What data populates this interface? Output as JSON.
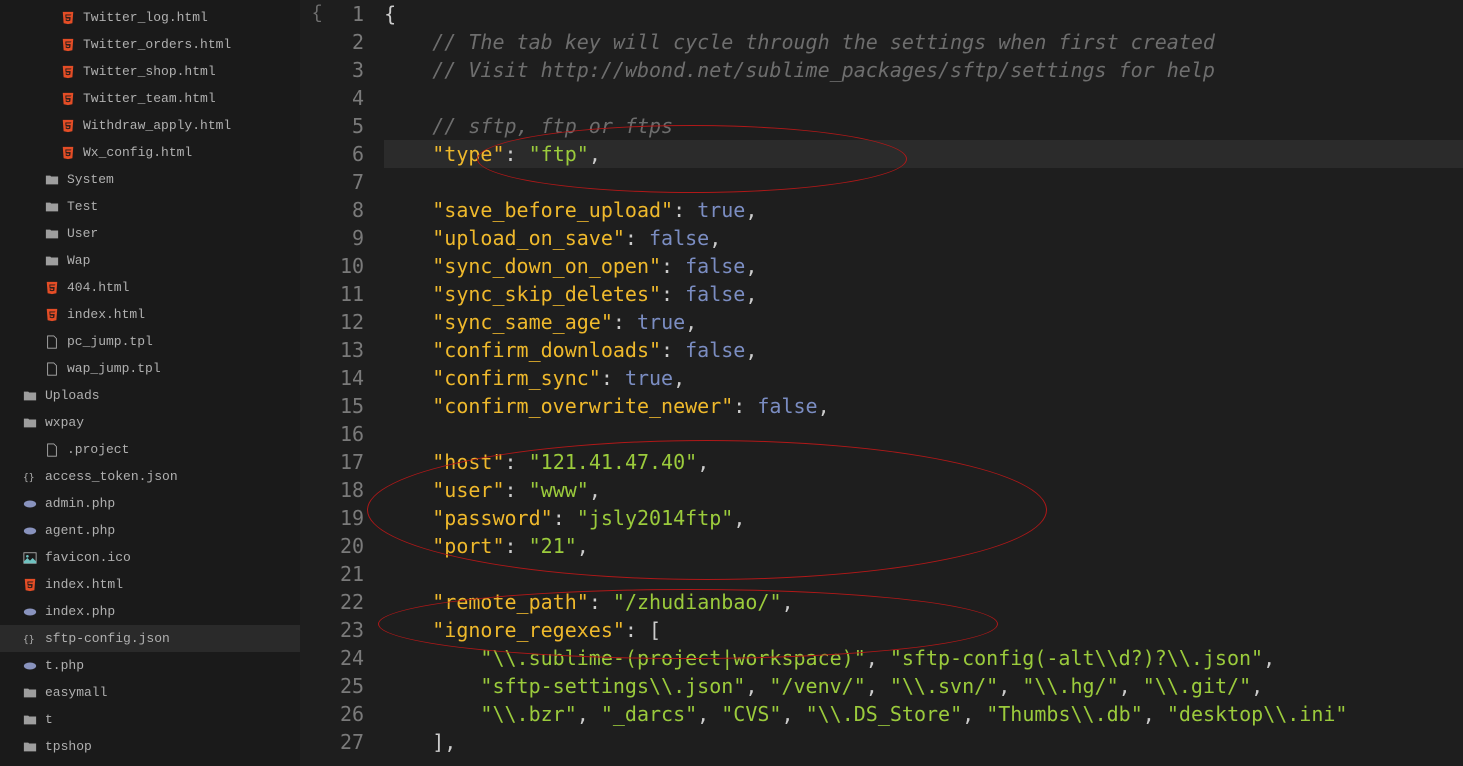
{
  "sidebar": {
    "items": [
      {
        "indent": 3,
        "icon": "html",
        "label": "Twitter_log.html",
        "active": false
      },
      {
        "indent": 3,
        "icon": "html",
        "label": "Twitter_orders.html",
        "active": false
      },
      {
        "indent": 3,
        "icon": "html",
        "label": "Twitter_shop.html",
        "active": false
      },
      {
        "indent": 3,
        "icon": "html",
        "label": "Twitter_team.html",
        "active": false
      },
      {
        "indent": 3,
        "icon": "html",
        "label": "Withdraw_apply.html",
        "active": false
      },
      {
        "indent": 3,
        "icon": "html",
        "label": "Wx_config.html",
        "active": false
      },
      {
        "indent": 2,
        "icon": "folder",
        "label": "System",
        "active": false
      },
      {
        "indent": 2,
        "icon": "folder",
        "label": "Test",
        "active": false
      },
      {
        "indent": 2,
        "icon": "folder",
        "label": "User",
        "active": false
      },
      {
        "indent": 2,
        "icon": "folder",
        "label": "Wap",
        "active": false
      },
      {
        "indent": 2,
        "icon": "html",
        "label": "404.html",
        "active": false
      },
      {
        "indent": 2,
        "icon": "html",
        "label": "index.html",
        "active": false
      },
      {
        "indent": 2,
        "icon": "file",
        "label": "pc_jump.tpl",
        "active": false
      },
      {
        "indent": 2,
        "icon": "file",
        "label": "wap_jump.tpl",
        "active": false
      },
      {
        "indent": 1,
        "icon": "folder",
        "label": "Uploads",
        "active": false
      },
      {
        "indent": 1,
        "icon": "folder",
        "label": "wxpay",
        "active": false
      },
      {
        "indent": 2,
        "icon": "file",
        "label": ".project",
        "active": false
      },
      {
        "indent": 1,
        "icon": "json",
        "label": "access_token.json",
        "active": false
      },
      {
        "indent": 1,
        "icon": "php",
        "label": "admin.php",
        "active": false
      },
      {
        "indent": 1,
        "icon": "php",
        "label": "agent.php",
        "active": false
      },
      {
        "indent": 1,
        "icon": "image",
        "label": "favicon.ico",
        "active": false
      },
      {
        "indent": 1,
        "icon": "html",
        "label": "index.html",
        "active": false
      },
      {
        "indent": 1,
        "icon": "php",
        "label": "index.php",
        "active": false
      },
      {
        "indent": 1,
        "icon": "json",
        "label": "sftp-config.json",
        "active": true
      },
      {
        "indent": 1,
        "icon": "php",
        "label": "t.php",
        "active": false
      },
      {
        "indent": 1,
        "icon": "folder",
        "label": "easymall",
        "active": false
      },
      {
        "indent": 1,
        "icon": "folder",
        "label": "t",
        "active": false
      },
      {
        "indent": 1,
        "icon": "folder",
        "label": "tpshop",
        "active": false
      }
    ]
  },
  "editor": {
    "lines": [
      {
        "n": 1,
        "tokens": [
          {
            "t": "{",
            "c": "brace"
          }
        ]
      },
      {
        "n": 2,
        "tokens": [
          {
            "t": "    ",
            "c": ""
          },
          {
            "t": "// The tab key will cycle through the settings when first created",
            "c": "comment"
          }
        ]
      },
      {
        "n": 3,
        "tokens": [
          {
            "t": "    ",
            "c": ""
          },
          {
            "t": "// Visit http://wbond.net/sublime_packages/sftp/settings for help",
            "c": "comment"
          }
        ]
      },
      {
        "n": 4,
        "tokens": []
      },
      {
        "n": 5,
        "tokens": [
          {
            "t": "    ",
            "c": ""
          },
          {
            "t": "// sftp, ftp or ftps",
            "c": "comment"
          }
        ]
      },
      {
        "n": 6,
        "hl": true,
        "tokens": [
          {
            "t": "    ",
            "c": ""
          },
          {
            "t": "\"type\"",
            "c": "key"
          },
          {
            "t": ": ",
            "c": "punct"
          },
          {
            "t": "\"ftp\"",
            "c": "str"
          },
          {
            "t": ",",
            "c": "punct"
          }
        ]
      },
      {
        "n": 7,
        "tokens": []
      },
      {
        "n": 8,
        "tokens": [
          {
            "t": "    ",
            "c": ""
          },
          {
            "t": "\"save_before_upload\"",
            "c": "key"
          },
          {
            "t": ": ",
            "c": "punct"
          },
          {
            "t": "true",
            "c": "bool"
          },
          {
            "t": ",",
            "c": "punct"
          }
        ]
      },
      {
        "n": 9,
        "tokens": [
          {
            "t": "    ",
            "c": ""
          },
          {
            "t": "\"upload_on_save\"",
            "c": "key"
          },
          {
            "t": ": ",
            "c": "punct"
          },
          {
            "t": "false",
            "c": "bool"
          },
          {
            "t": ",",
            "c": "punct"
          }
        ]
      },
      {
        "n": 10,
        "tokens": [
          {
            "t": "    ",
            "c": ""
          },
          {
            "t": "\"sync_down_on_open\"",
            "c": "key"
          },
          {
            "t": ": ",
            "c": "punct"
          },
          {
            "t": "false",
            "c": "bool"
          },
          {
            "t": ",",
            "c": "punct"
          }
        ]
      },
      {
        "n": 11,
        "tokens": [
          {
            "t": "    ",
            "c": ""
          },
          {
            "t": "\"sync_skip_deletes\"",
            "c": "key"
          },
          {
            "t": ": ",
            "c": "punct"
          },
          {
            "t": "false",
            "c": "bool"
          },
          {
            "t": ",",
            "c": "punct"
          }
        ]
      },
      {
        "n": 12,
        "tokens": [
          {
            "t": "    ",
            "c": ""
          },
          {
            "t": "\"sync_same_age\"",
            "c": "key"
          },
          {
            "t": ": ",
            "c": "punct"
          },
          {
            "t": "true",
            "c": "bool"
          },
          {
            "t": ",",
            "c": "punct"
          }
        ]
      },
      {
        "n": 13,
        "tokens": [
          {
            "t": "    ",
            "c": ""
          },
          {
            "t": "\"confirm_downloads\"",
            "c": "key"
          },
          {
            "t": ": ",
            "c": "punct"
          },
          {
            "t": "false",
            "c": "bool"
          },
          {
            "t": ",",
            "c": "punct"
          }
        ]
      },
      {
        "n": 14,
        "tokens": [
          {
            "t": "    ",
            "c": ""
          },
          {
            "t": "\"confirm_sync\"",
            "c": "key"
          },
          {
            "t": ": ",
            "c": "punct"
          },
          {
            "t": "true",
            "c": "bool"
          },
          {
            "t": ",",
            "c": "punct"
          }
        ]
      },
      {
        "n": 15,
        "tokens": [
          {
            "t": "    ",
            "c": ""
          },
          {
            "t": "\"confirm_overwrite_newer\"",
            "c": "key"
          },
          {
            "t": ": ",
            "c": "punct"
          },
          {
            "t": "false",
            "c": "bool"
          },
          {
            "t": ",",
            "c": "punct"
          }
        ]
      },
      {
        "n": 16,
        "tokens": []
      },
      {
        "n": 17,
        "tokens": [
          {
            "t": "    ",
            "c": ""
          },
          {
            "t": "\"host\"",
            "c": "key"
          },
          {
            "t": ": ",
            "c": "punct"
          },
          {
            "t": "\"121.41.47.40\"",
            "c": "str"
          },
          {
            "t": ",",
            "c": "punct"
          }
        ]
      },
      {
        "n": 18,
        "tokens": [
          {
            "t": "    ",
            "c": ""
          },
          {
            "t": "\"user\"",
            "c": "key"
          },
          {
            "t": ": ",
            "c": "punct"
          },
          {
            "t": "\"www\"",
            "c": "str"
          },
          {
            "t": ",",
            "c": "punct"
          }
        ]
      },
      {
        "n": 19,
        "tokens": [
          {
            "t": "    ",
            "c": ""
          },
          {
            "t": "\"password\"",
            "c": "key"
          },
          {
            "t": ": ",
            "c": "punct"
          },
          {
            "t": "\"jsly2014ftp\"",
            "c": "str"
          },
          {
            "t": ",",
            "c": "punct"
          }
        ]
      },
      {
        "n": 20,
        "tokens": [
          {
            "t": "    ",
            "c": ""
          },
          {
            "t": "\"port\"",
            "c": "key"
          },
          {
            "t": ": ",
            "c": "punct"
          },
          {
            "t": "\"21\"",
            "c": "str"
          },
          {
            "t": ",",
            "c": "punct"
          }
        ]
      },
      {
        "n": 21,
        "tokens": []
      },
      {
        "n": 22,
        "tokens": [
          {
            "t": "    ",
            "c": ""
          },
          {
            "t": "\"remote_path\"",
            "c": "key"
          },
          {
            "t": ": ",
            "c": "punct"
          },
          {
            "t": "\"/zhudianbao/\"",
            "c": "str"
          },
          {
            "t": ",",
            "c": "punct"
          }
        ]
      },
      {
        "n": 23,
        "tokens": [
          {
            "t": "    ",
            "c": ""
          },
          {
            "t": "\"ignore_regexes\"",
            "c": "key"
          },
          {
            "t": ": ",
            "c": "punct"
          },
          {
            "t": "[",
            "c": "brace"
          }
        ]
      },
      {
        "n": 24,
        "tokens": [
          {
            "t": "        ",
            "c": ""
          },
          {
            "t": "\"\\\\.sublime-(project|workspace)\"",
            "c": "str"
          },
          {
            "t": ", ",
            "c": "punct"
          },
          {
            "t": "\"sftp-config(-alt\\\\d?)?\\\\.json\"",
            "c": "str"
          },
          {
            "t": ",",
            "c": "punct"
          }
        ]
      },
      {
        "n": 25,
        "tokens": [
          {
            "t": "        ",
            "c": ""
          },
          {
            "t": "\"sftp-settings\\\\.json\"",
            "c": "str"
          },
          {
            "t": ", ",
            "c": "punct"
          },
          {
            "t": "\"/venv/\"",
            "c": "str"
          },
          {
            "t": ", ",
            "c": "punct"
          },
          {
            "t": "\"\\\\.svn/\"",
            "c": "str"
          },
          {
            "t": ", ",
            "c": "punct"
          },
          {
            "t": "\"\\\\.hg/\"",
            "c": "str"
          },
          {
            "t": ", ",
            "c": "punct"
          },
          {
            "t": "\"\\\\.git/\"",
            "c": "str"
          },
          {
            "t": ",",
            "c": "punct"
          }
        ]
      },
      {
        "n": 26,
        "tokens": [
          {
            "t": "        ",
            "c": ""
          },
          {
            "t": "\"\\\\.bzr\"",
            "c": "str"
          },
          {
            "t": ", ",
            "c": "punct"
          },
          {
            "t": "\"_darcs\"",
            "c": "str"
          },
          {
            "t": ", ",
            "c": "punct"
          },
          {
            "t": "\"CVS\"",
            "c": "str"
          },
          {
            "t": ", ",
            "c": "punct"
          },
          {
            "t": "\"\\\\.DS_Store\"",
            "c": "str"
          },
          {
            "t": ", ",
            "c": "punct"
          },
          {
            "t": "\"Thumbs\\\\.db\"",
            "c": "str"
          },
          {
            "t": ", ",
            "c": "punct"
          },
          {
            "t": "\"desktop\\\\.ini\"",
            "c": "str"
          }
        ]
      },
      {
        "n": 27,
        "tokens": [
          {
            "t": "    ",
            "c": ""
          },
          {
            "t": "],",
            "c": "brace"
          }
        ]
      }
    ]
  }
}
